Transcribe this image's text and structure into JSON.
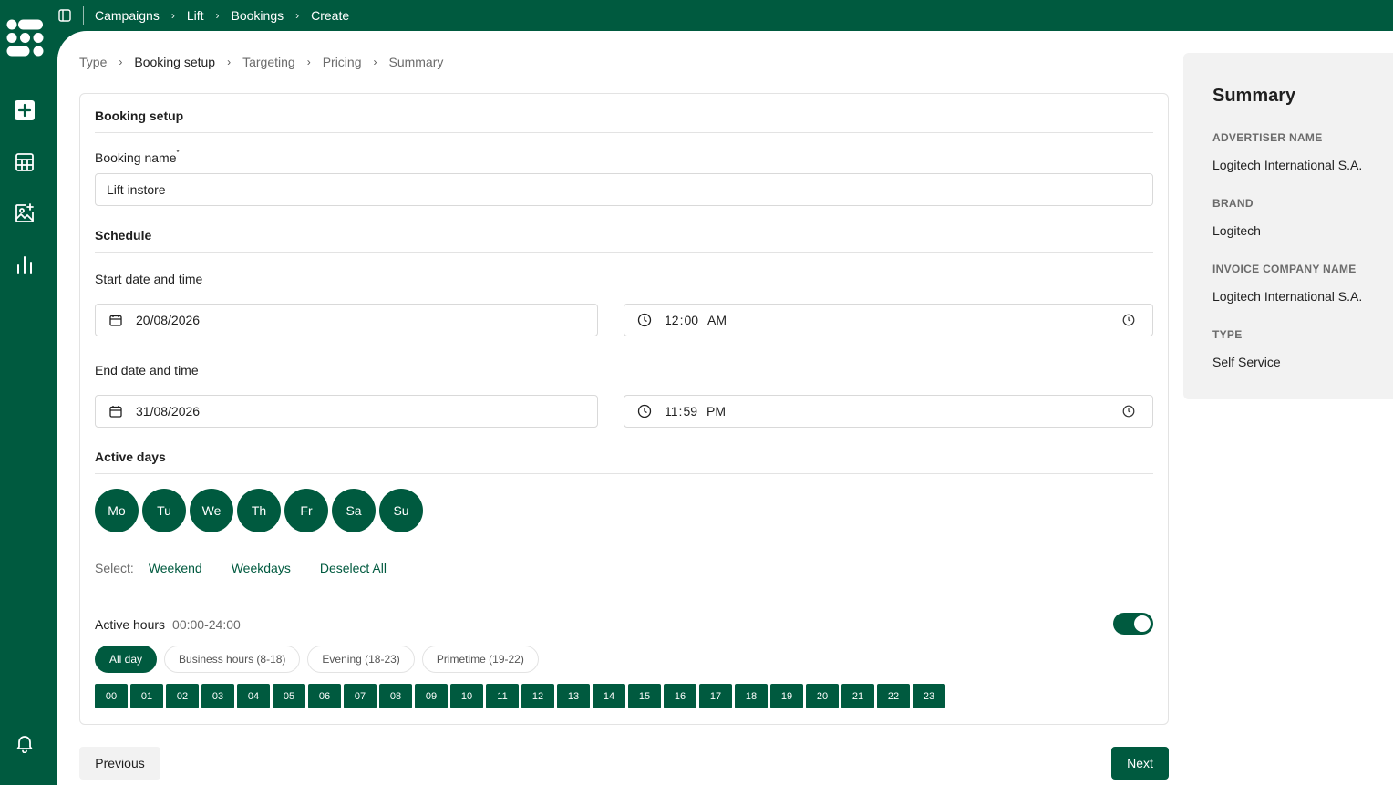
{
  "breadcrumb": [
    "Campaigns",
    "Lift",
    "Bookings",
    "Create"
  ],
  "steps": [
    {
      "label": "Type",
      "active": false
    },
    {
      "label": "Booking setup",
      "active": true
    },
    {
      "label": "Targeting",
      "active": false
    },
    {
      "label": "Pricing",
      "active": false
    },
    {
      "label": "Summary",
      "active": false
    }
  ],
  "booking_setup": {
    "title": "Booking setup",
    "name_label": "Booking name",
    "required_mark": "*",
    "name_value": "Lift instore"
  },
  "schedule": {
    "title": "Schedule",
    "start_label": "Start date and time",
    "start_date": "20/08/2026",
    "start_hour": "12",
    "start_minute": "00",
    "start_period": "AM",
    "end_label": "End date and time",
    "end_date": "31/08/2026",
    "end_hour": "11",
    "end_minute": "59",
    "end_period": "PM",
    "time_separator": ":"
  },
  "active_days": {
    "title": "Active days",
    "days": [
      "Mo",
      "Tu",
      "We",
      "Th",
      "Fr",
      "Sa",
      "Su"
    ],
    "select_label": "Select:",
    "links": [
      "Weekend",
      "Weekdays",
      "Deselect All"
    ]
  },
  "active_hours": {
    "label": "Active hours",
    "range": "00:00-24:00",
    "enabled": true,
    "presets": [
      {
        "label": "All day",
        "active": true
      },
      {
        "label": "Business hours (8-18)",
        "active": false
      },
      {
        "label": "Evening (18-23)",
        "active": false
      },
      {
        "label": "Primetime (19-22)",
        "active": false
      }
    ],
    "hours": [
      "00",
      "01",
      "02",
      "03",
      "04",
      "05",
      "06",
      "07",
      "08",
      "09",
      "10",
      "11",
      "12",
      "13",
      "14",
      "15",
      "16",
      "17",
      "18",
      "19",
      "20",
      "21",
      "22",
      "23"
    ]
  },
  "actions": {
    "previous": "Previous",
    "next": "Next"
  },
  "summary": {
    "title": "Summary",
    "fields": [
      {
        "key": "ADVERTISER NAME",
        "value": "Logitech International S.A."
      },
      {
        "key": "BRAND",
        "value": "Logitech"
      },
      {
        "key": "INVOICE COMPANY NAME",
        "value": "Logitech International S.A."
      },
      {
        "key": "TYPE",
        "value": "Self Service"
      }
    ]
  },
  "colors": {
    "brand": "#005a3f",
    "surface": "#ffffff",
    "muted_surface": "#f2f2f2"
  }
}
